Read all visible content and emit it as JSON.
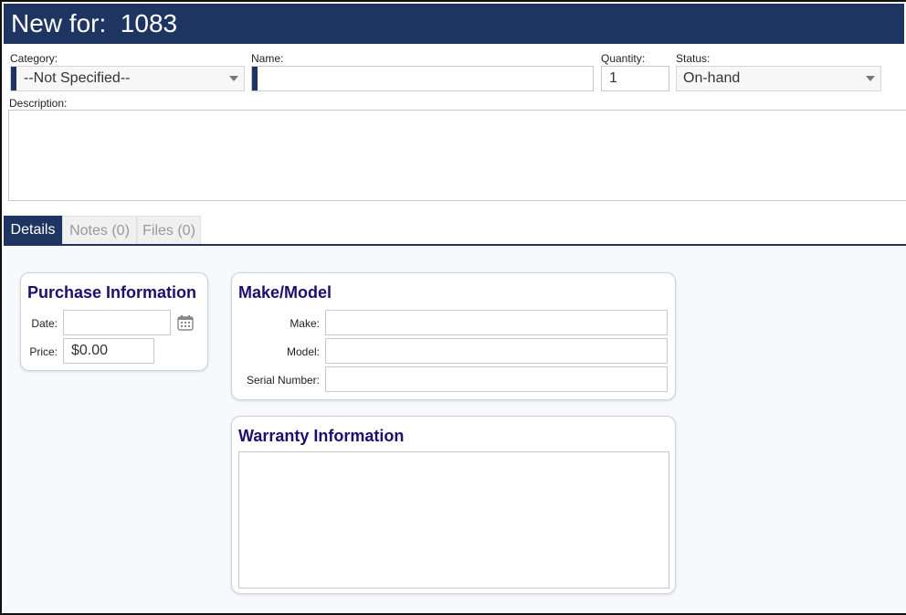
{
  "header": {
    "title": "New for:  1083"
  },
  "form": {
    "category": {
      "label": "Category:",
      "value": "--Not Specified--"
    },
    "name": {
      "label": "Name:",
      "value": ""
    },
    "quantity": {
      "label": "Quantity:",
      "value": "1"
    },
    "status": {
      "label": "Status:",
      "value": "On-hand"
    },
    "description": {
      "label": "Description:",
      "value": ""
    }
  },
  "tabs": [
    {
      "label": "Details",
      "active": true
    },
    {
      "label": "Notes (0)",
      "active": false
    },
    {
      "label": "Files (0)",
      "active": false
    }
  ],
  "purchase": {
    "title": "Purchase Information",
    "date_label": "Date:",
    "date_value": "",
    "price_label": "Price:",
    "price_value": "$0.00"
  },
  "make_model": {
    "title": "Make/Model",
    "make_label": "Make:",
    "model_label": "Model:",
    "serial_label": "Serial Number:"
  },
  "warranty": {
    "title": "Warranty Information"
  },
  "colors": {
    "accent": "#1f3561",
    "card_title": "#1a1070"
  }
}
